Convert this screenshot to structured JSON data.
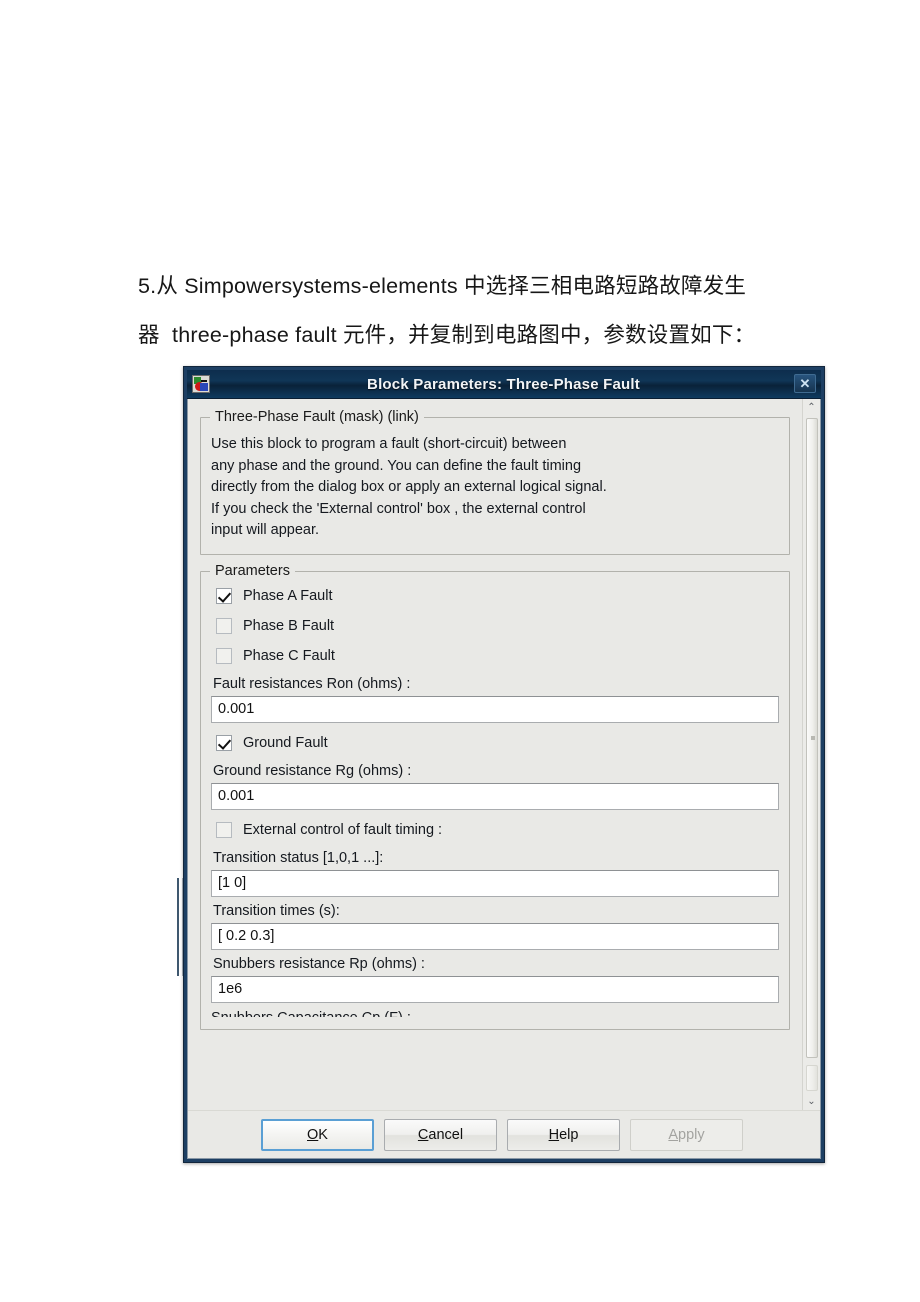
{
  "document": {
    "lines": [
      "5.从 Simpowersystems-elements 中选择三相电路短路故障发生",
      "器  three-phase fault 元件，并复制到电路图中，参数设置如下："
    ]
  },
  "background": {
    "caption": "Three-Phase Fault"
  },
  "dialog": {
    "title": "Block Parameters: Three-Phase Fault",
    "close_label": "✕",
    "description_group": {
      "legend": "Three-Phase Fault (mask) (link)",
      "text": "Use this block to program a fault (short-circuit) between\nany phase and the ground. You can define the fault timing\ndirectly from the dialog box or apply an external logical signal.\nIf you check the 'External control' box , the external control\ninput will appear."
    },
    "parameters_group": {
      "legend": "Parameters",
      "checkboxes": [
        {
          "label": "Phase A Fault",
          "checked": true
        },
        {
          "label": "Phase B Fault",
          "checked": false
        },
        {
          "label": "Phase C Fault",
          "checked": false
        }
      ],
      "fields": [
        {
          "label": "Fault resistances  Ron (ohms) :",
          "value": "0.001"
        }
      ],
      "ground_fault": {
        "label": "Ground Fault",
        "checked": true
      },
      "ground_resistance": {
        "label": "Ground resistance Rg (ohms) :",
        "value": "0.001"
      },
      "external_control": {
        "label": "External control of fault timing :",
        "checked": false
      },
      "transition_status": {
        "label": "Transition status [1,0,1 ...]:",
        "value": "[1 0]"
      },
      "transition_times": {
        "label": "Transition times (s):",
        "value": "[ 0.2 0.3]"
      },
      "snubbers_resistance": {
        "label": "Snubbers resistance Rp (ohms) :",
        "value": "1e6"
      },
      "clipped_label": "Snubbers Capacitance Cp (F) :"
    },
    "scrollbar": {
      "up_arrow": "⌃",
      "down_arrow": "⌄"
    },
    "buttons": {
      "ok": {
        "mnemonic": "O",
        "rest": "K"
      },
      "cancel": {
        "mnemonic": "C",
        "rest": "ancel"
      },
      "help": {
        "mnemonic": "H",
        "rest": "elp"
      },
      "apply": {
        "mnemonic": "A",
        "rest": "pply",
        "disabled": true
      }
    }
  },
  "colors": {
    "title_bar": "#0d2d4d",
    "dialog_border": "#1d3f63",
    "dialog_face": "#e9e9e6",
    "default_button_outline": "#5a9fd4"
  }
}
